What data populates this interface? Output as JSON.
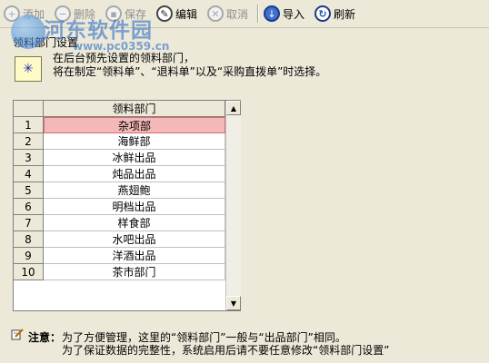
{
  "toolbar": {
    "buttons": [
      {
        "label": "添加",
        "icon": "add-icon",
        "enabled": false
      },
      {
        "label": "删除",
        "icon": "delete-icon",
        "enabled": false
      },
      {
        "label": "保存",
        "icon": "save-icon",
        "enabled": false
      },
      {
        "label": "编辑",
        "icon": "edit-icon",
        "enabled": true
      },
      {
        "label": "取消",
        "icon": "cancel-icon",
        "enabled": false
      },
      {
        "label": "导入",
        "icon": "import-icon",
        "enabled": true
      },
      {
        "label": "刷新",
        "icon": "refresh-icon",
        "enabled": true
      }
    ]
  },
  "watermark": {
    "title": "河东软件园",
    "url": "www.pc0359.cn"
  },
  "section_title": "领料部门设置",
  "info": {
    "line1": "在后台预先设置的领料部门，",
    "line2": "将在制定“领料单”、“退料单”以及“采购直拨单”时选择。"
  },
  "grid": {
    "column_header": "领料部门",
    "rows": [
      {
        "num": "1",
        "dept": "杂项部",
        "selected": true
      },
      {
        "num": "2",
        "dept": "海鲜部"
      },
      {
        "num": "3",
        "dept": "冰鲜出品"
      },
      {
        "num": "4",
        "dept": "炖品出品"
      },
      {
        "num": "5",
        "dept": "燕翅鲍"
      },
      {
        "num": "6",
        "dept": "明档出品"
      },
      {
        "num": "7",
        "dept": "样食部"
      },
      {
        "num": "8",
        "dept": "水吧出品"
      },
      {
        "num": "9",
        "dept": "洋酒出品"
      },
      {
        "num": "10",
        "dept": "茶市部门"
      }
    ]
  },
  "note": {
    "label": "注意：",
    "line1": "为了方便管理，这里的“领料部门”一般与“出品部门”相同。",
    "line2": "为了保证数据的完整性，系统启用后请不要任意修改“领料部门设置”"
  },
  "colors": {
    "selected_row": "#f4b8b8",
    "background": "#ece9d8",
    "watermark": "#1f63c9"
  }
}
